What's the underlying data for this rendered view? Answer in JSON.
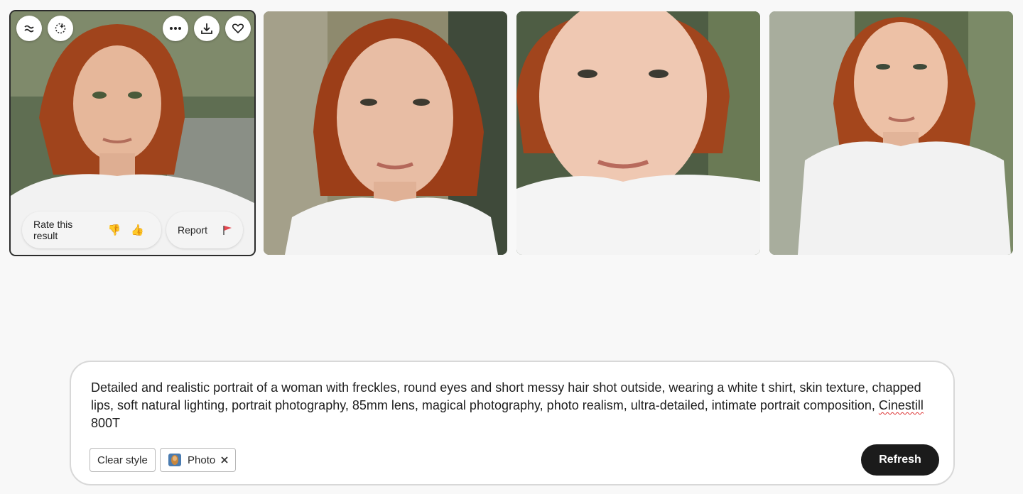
{
  "gallery": {
    "images": [
      {
        "alt": "freckled woman portrait 1"
      },
      {
        "alt": "freckled woman portrait 2"
      },
      {
        "alt": "freckled woman portrait 3"
      },
      {
        "alt": "freckled woman portrait 4"
      }
    ],
    "selected_tile": {
      "rate_label": "Rate this result",
      "report_label": "Report"
    }
  },
  "prompt": {
    "text_before": "Detailed and realistic portrait of a woman with freckles, round eyes and short messy hair shot outside, wearing a white t shirt, skin texture, chapped lips, soft natural lighting, portrait photography, 85mm lens, magical photography, photo realism, ultra-detailed, intimate portrait composition, ",
    "misspelled": "Cinestill",
    "text_after": " 800T",
    "clear_style_label": "Clear style",
    "style_tag": "Photo",
    "refresh_label": "Refresh"
  },
  "icons": {
    "tile_left": [
      "filter-icon",
      "sparkle-select-icon"
    ],
    "tile_right": [
      "more-icon",
      "download-icon",
      "heart-icon"
    ],
    "thumbs_down": "👎",
    "thumbs_up": "👍",
    "flag_color": "#e34850"
  }
}
